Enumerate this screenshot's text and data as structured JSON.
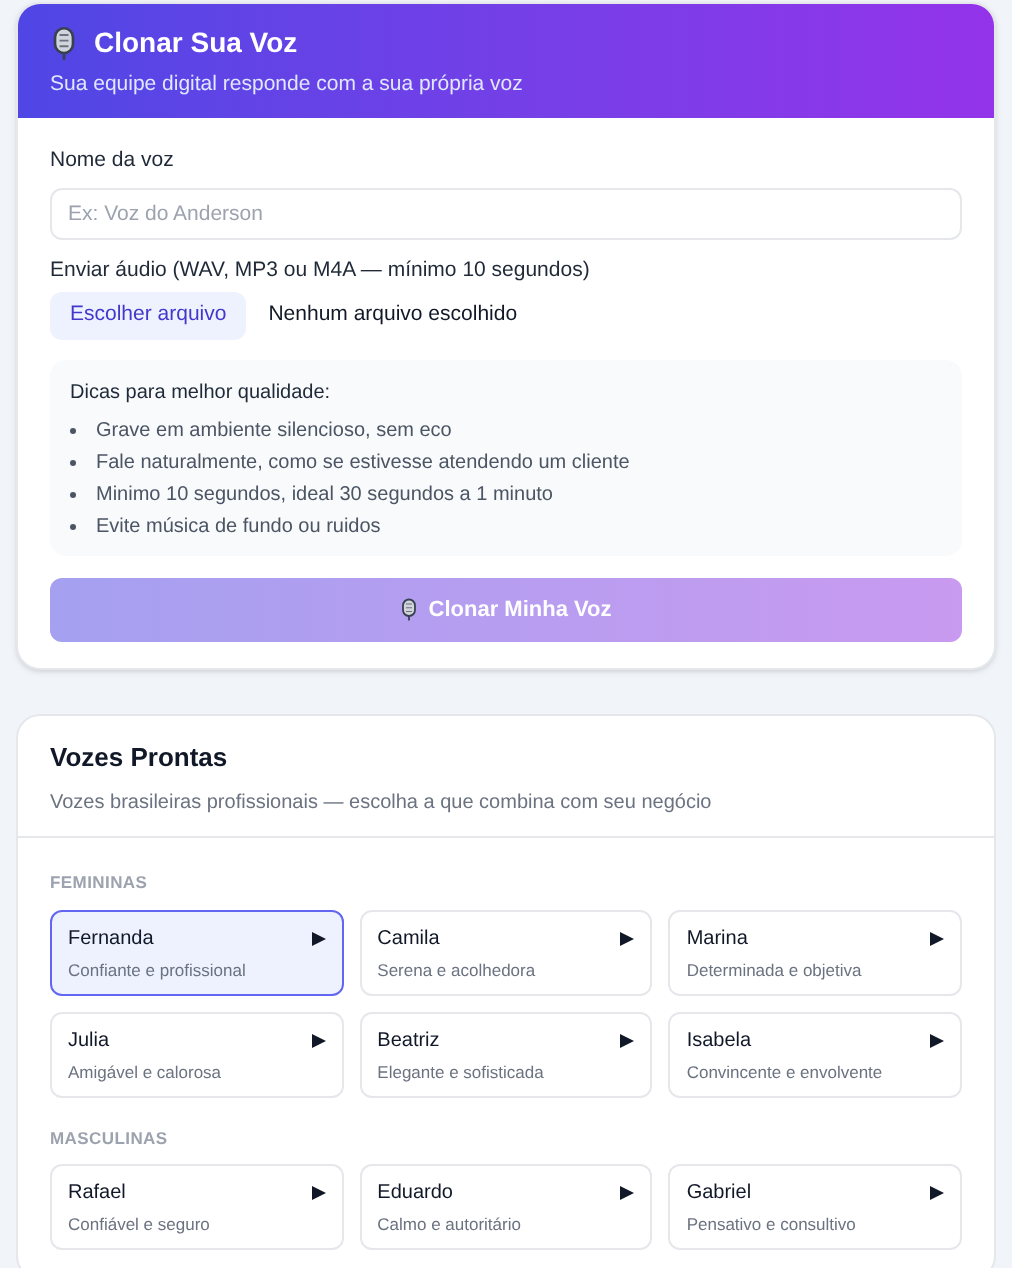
{
  "clone": {
    "title": "Clonar Sua Voz",
    "subtitle": "Sua equipe digital responde com a sua própria voz",
    "name_label": "Nome da voz",
    "name_field": {
      "placeholder": "Ex: Voz do Anderson"
    },
    "audio_label": "Enviar áudio (WAV, MP3 ou M4A — mínimo 10 segundos)",
    "file_button": "Escolher arquivo",
    "file_status": "Nenhum arquivo escolhido",
    "tips_title": "Dicas para melhor qualidade:",
    "tips": [
      "Grave em ambiente silencioso, sem eco",
      "Fale naturalmente, como se estivesse atendendo um cliente",
      "Minimo 10 segundos, ideal 30 segundos a 1 minuto",
      "Evite música de fundo ou ruidos"
    ],
    "submit": {
      "label": "Clonar Minha Voz",
      "disabled": true
    }
  },
  "ready": {
    "title": "Vozes Prontas",
    "subtitle": "Vozes brasileiras profissionais — escolha a que combina com seu negócio",
    "groups": [
      {
        "label": "FEMININAS",
        "voices": [
          {
            "name": "Fernanda",
            "desc": "Confiante e profissional",
            "selected": true
          },
          {
            "name": "Camila",
            "desc": "Serena e acolhedora",
            "selected": false
          },
          {
            "name": "Marina",
            "desc": "Determinada e objetiva",
            "selected": false
          },
          {
            "name": "Julia",
            "desc": "Amigável e calorosa",
            "selected": false
          },
          {
            "name": "Beatriz",
            "desc": "Elegante e sofisticada",
            "selected": false
          },
          {
            "name": "Isabela",
            "desc": "Convincente e envolvente",
            "selected": false
          }
        ]
      },
      {
        "label": "MASCULINAS",
        "voices": [
          {
            "name": "Rafael",
            "desc": "Confiável e seguro",
            "selected": false
          },
          {
            "name": "Eduardo",
            "desc": "Calmo e autoritário",
            "selected": false
          },
          {
            "name": "Gabriel",
            "desc": "Pensativo e consultivo",
            "selected": false
          }
        ]
      }
    ]
  }
}
